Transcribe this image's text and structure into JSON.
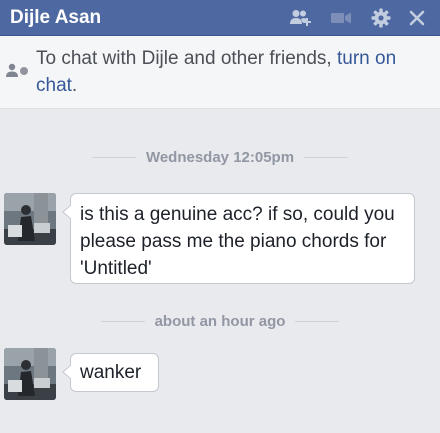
{
  "header": {
    "title": "Dijle Asan",
    "icons": [
      "add-friend-icon",
      "video-call-icon",
      "gear-icon",
      "close-icon"
    ]
  },
  "notice": {
    "prefix": "To chat with Dijle and other friends,",
    "link": "turn on chat",
    "suffix": "."
  },
  "messages": [
    {
      "timestamp": "Wednesday 12:05pm",
      "text": "is this a genuine acc? if so, could you please pass me the piano chords for 'Untitled'"
    },
    {
      "timestamp": "about an hour ago",
      "text": "wanker"
    }
  ],
  "colors": {
    "header": "#4e69a2",
    "background": "#e9eaed",
    "link": "#365899"
  }
}
